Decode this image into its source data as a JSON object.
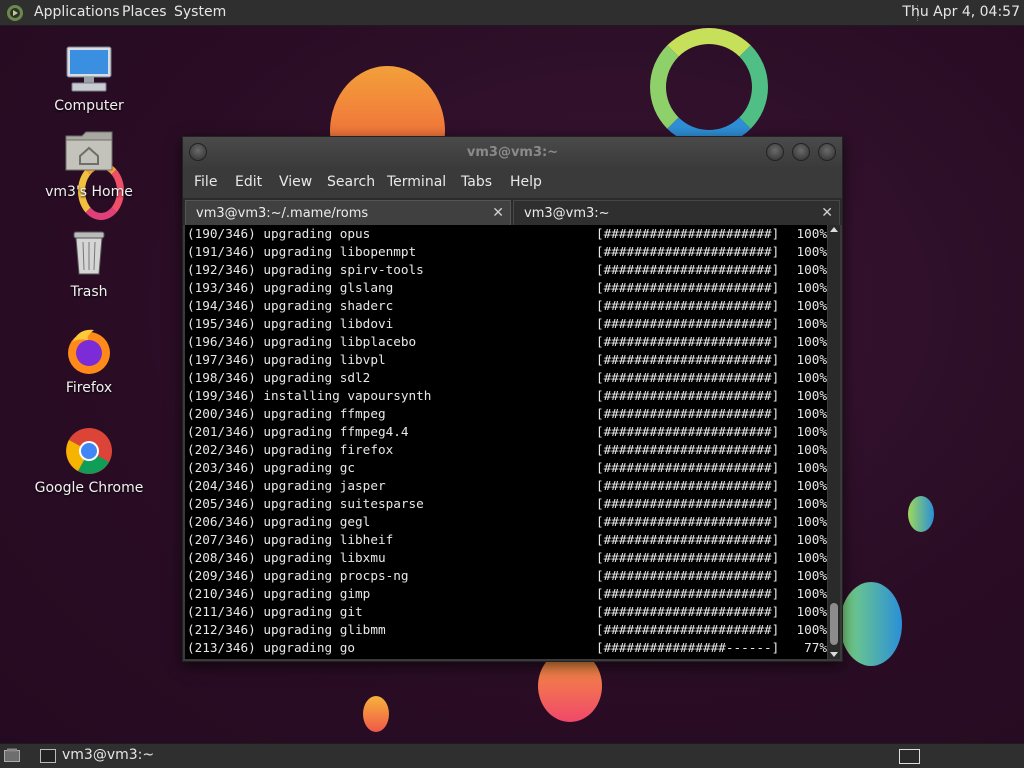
{
  "top_panel": {
    "menus": [
      "Applications",
      "Places",
      "System"
    ],
    "clock": "Thu Apr  4, 04:57"
  },
  "desktop_icons": [
    {
      "label": "Computer",
      "icon": "computer-icon"
    },
    {
      "label": "vm3's Home",
      "icon": "home-folder-icon"
    },
    {
      "label": "Trash",
      "icon": "trash-icon"
    },
    {
      "label": "Firefox",
      "icon": "firefox-icon"
    },
    {
      "label": "Google Chrome",
      "icon": "chrome-icon"
    }
  ],
  "window": {
    "title": "vm3@vm3:~",
    "menubar": [
      "File",
      "Edit",
      "View",
      "Search",
      "Terminal",
      "Tabs",
      "Help"
    ],
    "tabs": [
      {
        "label": "vm3@vm3:~/.mame/roms",
        "active": true
      },
      {
        "label": "vm3@vm3:~",
        "active": false
      }
    ],
    "close_glyph": "✕"
  },
  "terminal_lines": [
    {
      "text": "(190/346) upgrading opus",
      "bar": "[######################]",
      "pct": "100%"
    },
    {
      "text": "(191/346) upgrading libopenmpt",
      "bar": "[######################]",
      "pct": "100%"
    },
    {
      "text": "(192/346) upgrading spirv-tools",
      "bar": "[######################]",
      "pct": "100%"
    },
    {
      "text": "(193/346) upgrading glslang",
      "bar": "[######################]",
      "pct": "100%"
    },
    {
      "text": "(194/346) upgrading shaderc",
      "bar": "[######################]",
      "pct": "100%"
    },
    {
      "text": "(195/346) upgrading libdovi",
      "bar": "[######################]",
      "pct": "100%"
    },
    {
      "text": "(196/346) upgrading libplacebo",
      "bar": "[######################]",
      "pct": "100%"
    },
    {
      "text": "(197/346) upgrading libvpl",
      "bar": "[######################]",
      "pct": "100%"
    },
    {
      "text": "(198/346) upgrading sdl2",
      "bar": "[######################]",
      "pct": "100%"
    },
    {
      "text": "(199/346) installing vapoursynth",
      "bar": "[######################]",
      "pct": "100%"
    },
    {
      "text": "(200/346) upgrading ffmpeg",
      "bar": "[######################]",
      "pct": "100%"
    },
    {
      "text": "(201/346) upgrading ffmpeg4.4",
      "bar": "[######################]",
      "pct": "100%"
    },
    {
      "text": "(202/346) upgrading firefox",
      "bar": "[######################]",
      "pct": "100%"
    },
    {
      "text": "(203/346) upgrading gc",
      "bar": "[######################]",
      "pct": "100%"
    },
    {
      "text": "(204/346) upgrading jasper",
      "bar": "[######################]",
      "pct": "100%"
    },
    {
      "text": "(205/346) upgrading suitesparse",
      "bar": "[######################]",
      "pct": "100%"
    },
    {
      "text": "(206/346) upgrading gegl",
      "bar": "[######################]",
      "pct": "100%"
    },
    {
      "text": "(207/346) upgrading libheif",
      "bar": "[######################]",
      "pct": "100%"
    },
    {
      "text": "(208/346) upgrading libxmu",
      "bar": "[######################]",
      "pct": "100%"
    },
    {
      "text": "(209/346) upgrading procps-ng",
      "bar": "[######################]",
      "pct": "100%"
    },
    {
      "text": "(210/346) upgrading gimp",
      "bar": "[######################]",
      "pct": "100%"
    },
    {
      "text": "(211/346) upgrading git",
      "bar": "[######################]",
      "pct": "100%"
    },
    {
      "text": "(212/346) upgrading glibmm",
      "bar": "[######################]",
      "pct": "100%"
    },
    {
      "text": "(213/346) upgrading go",
      "bar": "[################------]",
      "pct": "77%"
    }
  ],
  "bottom_panel": {
    "task_label": "vm3@vm3:~"
  },
  "colors": {
    "wallpaper": "#2b0f26",
    "panel": "#2f2f2f",
    "terminal_bg": "#000000",
    "terminal_fg": "#e8e8e8"
  }
}
